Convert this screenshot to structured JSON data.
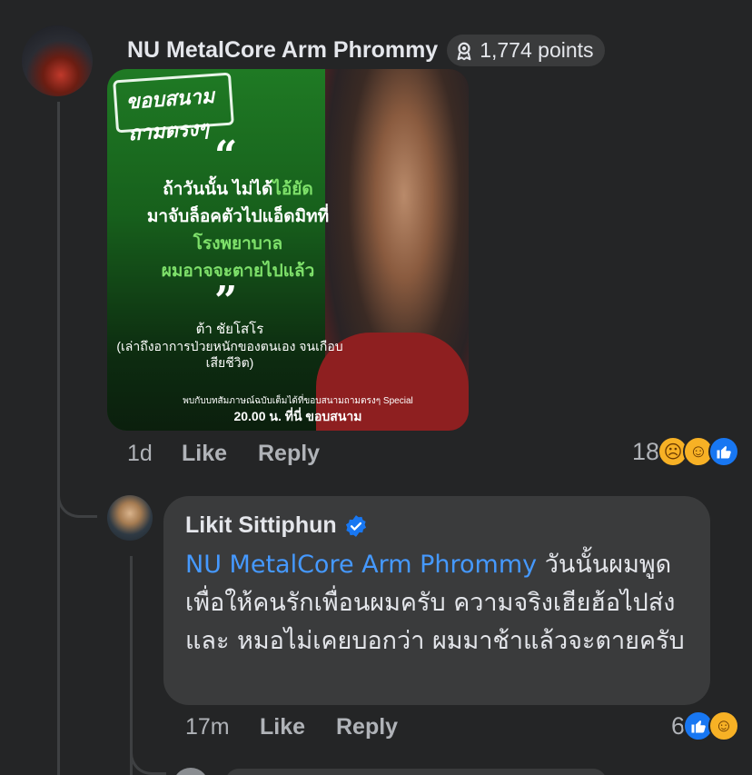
{
  "comment": {
    "author": "NU MetalCore Arm Phrommy",
    "points": "1,774 points",
    "time": "1d",
    "like_label": "Like",
    "reply_label": "Reply",
    "reaction_count": "18",
    "reactions": [
      "sad-icon",
      "haha-icon",
      "like-icon"
    ],
    "image": {
      "logo_text": "ขอบสนาม ถามตรงๆ",
      "quote_open": "“",
      "quote_lines": [
        "ถ้าวันนั้น ไม่ได้",
        "ไอ้ยัด",
        "มาจับล็อคตัวไปแอ็ดมิทที่",
        "โรงพยาบาล",
        "ผมอาจจะตายไปแล้ว"
      ],
      "quote_close": "”",
      "speaker_name": "ต้า ชัยโสโร",
      "speaker_desc": "(เล่าถึงอาการป่วยหนักของตนเอง จนเกือบเสียชีวิต)",
      "footer_line": "พบกับบทสัมภาษณ์ฉบับเต็มได้ที่ขอบสนามถามตรงๆ Special",
      "footer_time": "20.00 น. ที่นี่ ขอบสนาม"
    }
  },
  "reply": {
    "author": "Likit Sittiphun",
    "mention": "NU MetalCore Arm Phrommy",
    "text": " วันนั้นผมพูด เพื่อให้คนรักเพื่อนผมครับ ความจริงเฮียฮ้อไปส่ง และ หมอไม่เคยบอกว่า ผมมาช้าแล้วจะตายครับ",
    "time": "17m",
    "like_label": "Like",
    "reply_label": "Reply",
    "reaction_count": "6",
    "reactions": [
      "like-icon",
      "haha-icon"
    ]
  },
  "colors": {
    "background": "#242526",
    "bubble": "#3a3b3c",
    "mention": "#4599ff",
    "like_blue": "#1877f2",
    "emoji_yellow": "#f7b125"
  }
}
